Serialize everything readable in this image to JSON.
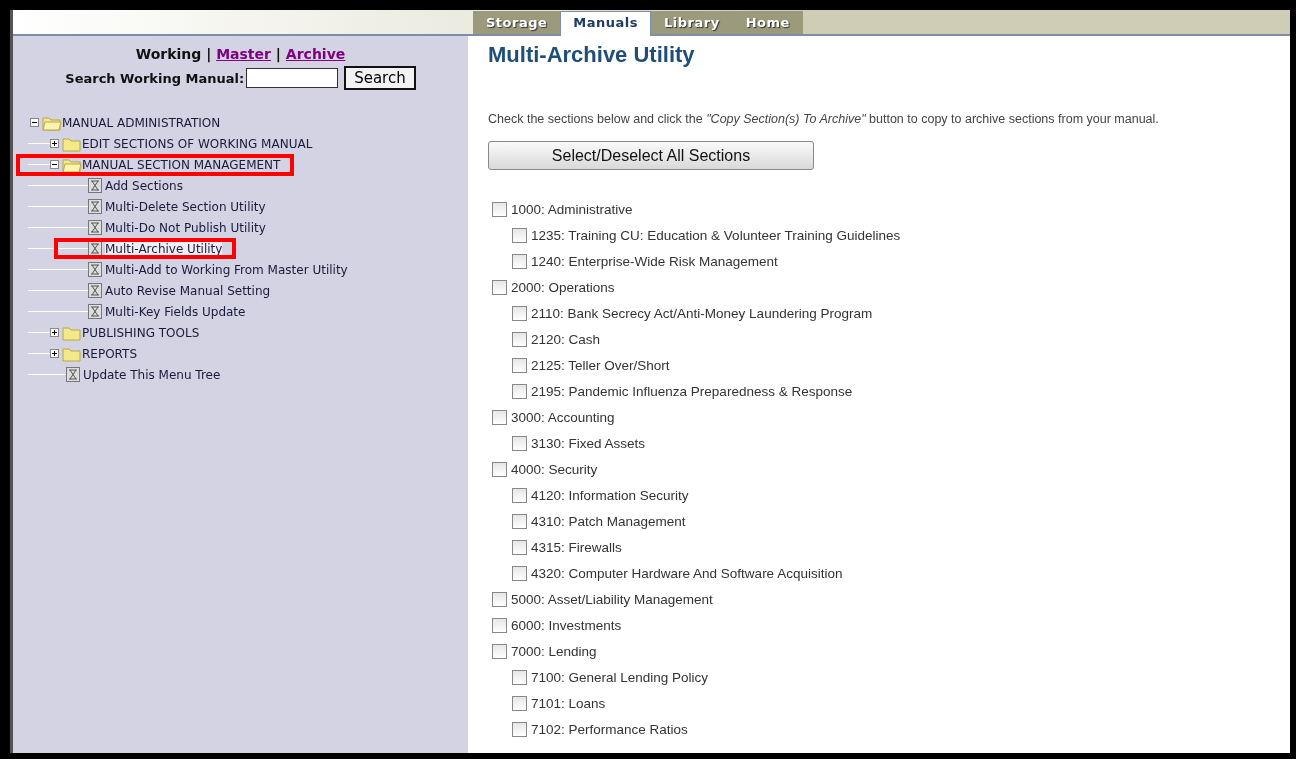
{
  "tabs": [
    {
      "label": "Storage",
      "selected": false
    },
    {
      "label": "Manuals",
      "selected": true
    },
    {
      "label": "Library",
      "selected": false
    },
    {
      "label": "Home",
      "selected": false
    }
  ],
  "sidebar": {
    "views": [
      {
        "label": "Working",
        "selected": true
      },
      {
        "label": "Master",
        "selected": false
      },
      {
        "label": "Archive",
        "selected": false
      }
    ],
    "separator": "|",
    "search": {
      "label": "Search Working Manual:",
      "button": "Search"
    },
    "tree": [
      {
        "label": "MANUAL ADMINISTRATION",
        "kind": "folder",
        "expanded": true,
        "annotated": false,
        "selected": false,
        "children": [
          {
            "label": "EDIT SECTIONS OF WORKING MANUAL",
            "kind": "folder",
            "expanded": false,
            "annotated": false,
            "selected": false
          },
          {
            "label": "MANUAL SECTION MANAGEMENT",
            "kind": "folder",
            "expanded": true,
            "annotated": true,
            "selected": false,
            "children": [
              {
                "label": "Add Sections",
                "kind": "page",
                "annotated": false,
                "selected": false
              },
              {
                "label": "Multi-Delete Section Utility",
                "kind": "page",
                "annotated": false,
                "selected": false
              },
              {
                "label": "Multi-Do Not Publish Utility",
                "kind": "page",
                "annotated": false,
                "selected": false
              },
              {
                "label": "Multi-Archive Utility",
                "kind": "page",
                "annotated": true,
                "selected": true
              },
              {
                "label": "Multi-Add to Working From Master Utility",
                "kind": "page",
                "annotated": false,
                "selected": false
              },
              {
                "label": "Auto Revise Manual Setting",
                "kind": "page",
                "annotated": false,
                "selected": false
              },
              {
                "label": "Multi-Key Fields Update",
                "kind": "page",
                "annotated": false,
                "selected": false
              }
            ]
          },
          {
            "label": "PUBLISHING TOOLS",
            "kind": "folder",
            "expanded": false,
            "annotated": false,
            "selected": false
          },
          {
            "label": "REPORTS",
            "kind": "folder",
            "expanded": false,
            "annotated": false,
            "selected": false
          },
          {
            "label": "Update This Menu Tree",
            "kind": "page",
            "annotated": false,
            "selected": false
          }
        ]
      }
    ]
  },
  "main": {
    "title": "Multi-Archive Utility",
    "instructions": "Check the sections below and click the *\"Copy Section(s) To Archive\"* button to copy to archive sections from your manual.",
    "select_all_button": "Select/Deselect All Sections",
    "sections": [
      {
        "label": "1000: Administrative",
        "checked": false,
        "children": [
          {
            "label": "1235: Training CU: Education & Volunteer Training Guidelines",
            "checked": false
          },
          {
            "label": "1240: Enterprise-Wide Risk Management",
            "checked": false
          }
        ]
      },
      {
        "label": "2000: Operations",
        "checked": false,
        "children": [
          {
            "label": "2110: Bank Secrecy Act/Anti-Money Laundering Program",
            "checked": false
          },
          {
            "label": "2120: Cash",
            "checked": false
          },
          {
            "label": "2125: Teller Over/Short",
            "checked": false
          },
          {
            "label": "2195: Pandemic Influenza Preparedness & Response",
            "checked": false
          }
        ]
      },
      {
        "label": "3000: Accounting",
        "checked": false,
        "children": [
          {
            "label": "3130: Fixed Assets",
            "checked": false
          }
        ]
      },
      {
        "label": "4000: Security",
        "checked": false,
        "children": [
          {
            "label": "4120: Information Security",
            "checked": false
          },
          {
            "label": "4310: Patch Management",
            "checked": false
          },
          {
            "label": "4315: Firewalls",
            "checked": false
          },
          {
            "label": "4320: Computer Hardware And Software Acquisition",
            "checked": false
          }
        ]
      },
      {
        "label": "5000: Asset/Liability Management",
        "checked": false
      },
      {
        "label": "6000: Investments",
        "checked": false
      },
      {
        "label": "7000: Lending",
        "checked": false,
        "children": [
          {
            "label": "7100: General Lending Policy",
            "checked": false
          },
          {
            "label": "7101: Loans",
            "checked": false
          },
          {
            "label": "7102: Performance Ratios",
            "checked": false
          }
        ]
      }
    ]
  }
}
